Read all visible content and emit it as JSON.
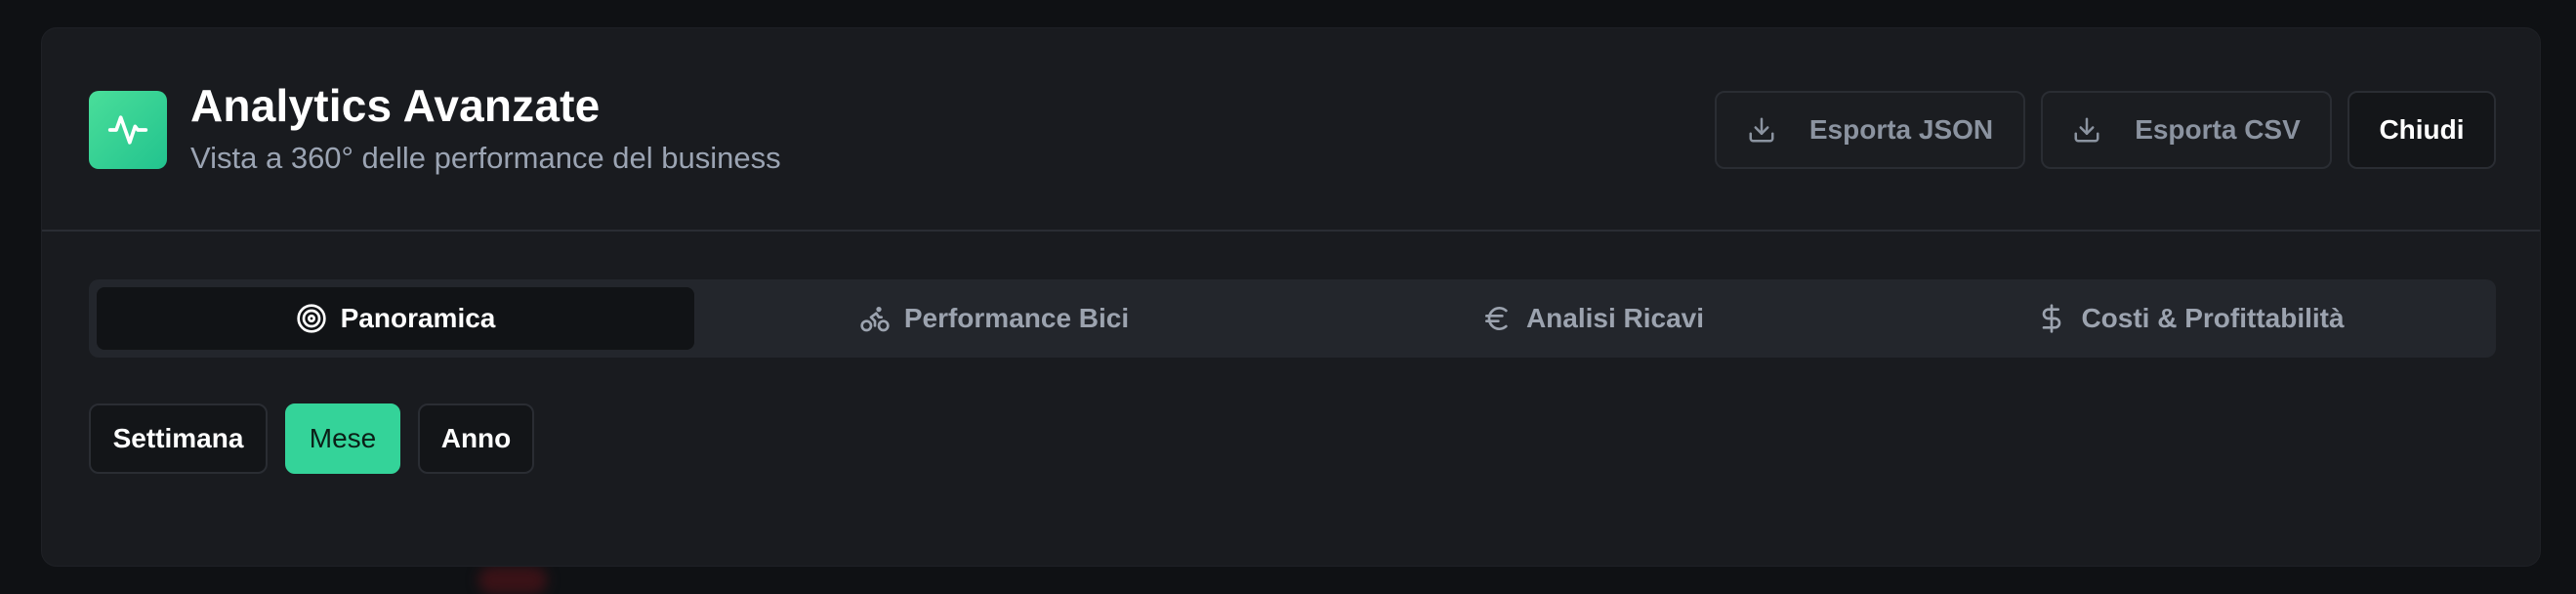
{
  "header": {
    "title": "Analytics Avanzate",
    "subtitle": "Vista a 360° delle performance del business",
    "logo_icon": "activity-pulse-icon",
    "accent_color": "#34d399"
  },
  "actions": {
    "export_json": "Esporta JSON",
    "export_csv": "Esporta CSV",
    "close": "Chiudi"
  },
  "tabs": [
    {
      "label": "Panoramica",
      "icon": "target-icon",
      "active": true
    },
    {
      "label": "Performance Bici",
      "icon": "bike-icon",
      "active": false
    },
    {
      "label": "Analisi Ricavi",
      "icon": "euro-icon",
      "active": false
    },
    {
      "label": "Costi & Profittabilità",
      "icon": "dollar-icon",
      "active": false
    }
  ],
  "period": {
    "options": [
      "Settimana",
      "Mese",
      "Anno"
    ],
    "selected": "Mese"
  }
}
